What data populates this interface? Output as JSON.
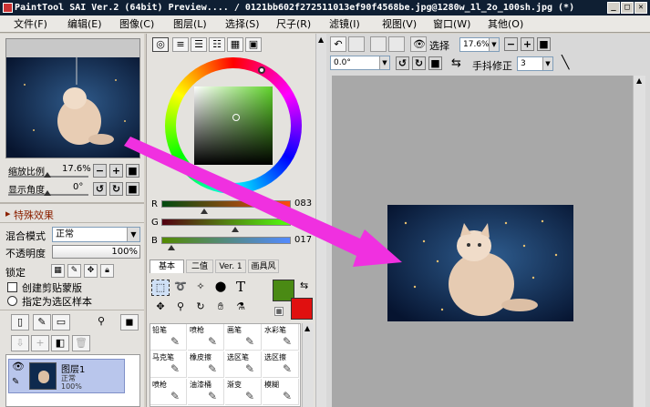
{
  "window": {
    "title": "PaintTool SAI Ver.2 (64bit) Preview.... / 0121bb602f272511013ef90f4568be.jpg@1280w_1l_2o_100sh.jpg (*)",
    "min": "_",
    "max": "□",
    "close": "✕"
  },
  "menu": [
    "文件(F)",
    "编辑(E)",
    "图像(C)",
    "图层(L)",
    "选择(S)",
    "尺子(R)",
    "滤镜(I)",
    "视图(V)",
    "窗口(W)",
    "其他(O)"
  ],
  "navigator": {
    "zoom_label": "缩放比例",
    "zoom_value": "17.6%",
    "angle_label": "显示角度",
    "angle_value": "0°"
  },
  "effects": {
    "label": "特殊效果"
  },
  "layer_props": {
    "blend_label": "混合模式",
    "blend_value": "正常",
    "opacity_label": "不透明度",
    "opacity_value": "100%",
    "lock_label": "锁定",
    "clip_label": "创建剪贴蒙版",
    "sample_label": "指定为选区样本"
  },
  "layer": {
    "name": "图层1",
    "mode": "正常",
    "opacity": "100%"
  },
  "color": {
    "r_label": "R",
    "r_value": "083",
    "g_label": "G",
    "g_value": "",
    "b_label": "B",
    "b_value": "017",
    "primary": "#4a8a14",
    "secondary": "#e01010"
  },
  "tool_tabs": [
    "基本",
    "二值",
    "Ver. 1",
    "画具风"
  ],
  "brushes": [
    {
      "name": "铅笔"
    },
    {
      "name": "喷枪"
    },
    {
      "name": "画笔"
    },
    {
      "name": "水彩笔"
    },
    {
      "name": "马克笔"
    },
    {
      "name": "橡皮擦"
    },
    {
      "name": "选区笔"
    },
    {
      "name": "选区擦"
    },
    {
      "name": "喷枪"
    },
    {
      "name": "油漆桶"
    },
    {
      "name": "渐变"
    },
    {
      "name": "模糊"
    }
  ],
  "view_toolbar": {
    "selection_label": "选择",
    "zoom_value": "17.6%",
    "angle_value": "0.0°",
    "stabilizer_label": "手抖修正",
    "stabilizer_value": "3"
  }
}
